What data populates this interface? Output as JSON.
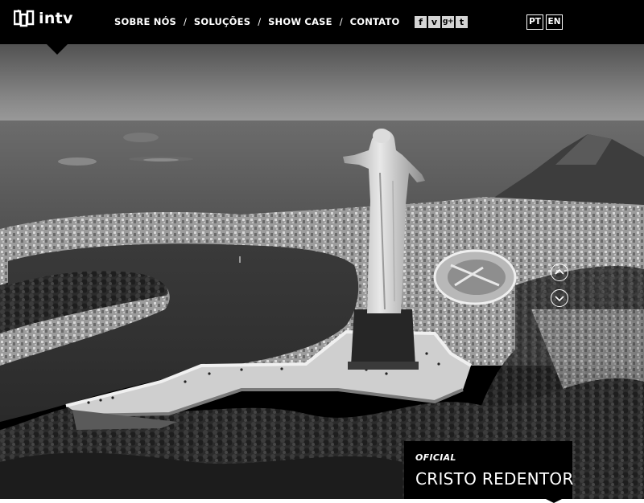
{
  "brand": {
    "name": "intv"
  },
  "nav": {
    "items": [
      {
        "label": "SOBRE NÓS"
      },
      {
        "label": "SOLUÇÕES"
      },
      {
        "label": "SHOW CASE"
      },
      {
        "label": "CONTATO"
      }
    ],
    "separator": "/"
  },
  "social": {
    "items": [
      {
        "icon": "facebook-icon",
        "glyph": "f"
      },
      {
        "icon": "vimeo-icon",
        "glyph": "v"
      },
      {
        "icon": "google-plus-icon",
        "glyph": "g+"
      },
      {
        "icon": "tumblr-icon",
        "glyph": "t"
      }
    ]
  },
  "languages": [
    {
      "code": "PT"
    },
    {
      "code": "EN"
    }
  ],
  "hero": {
    "image": "black-and-white aerial photograph of a statue on a mountain overlooking a city, lagoon and sea",
    "controls": {
      "up_icon": "chevron-up-icon",
      "down_icon": "chevron-down-icon"
    },
    "caption": {
      "kicker": "OFICIAL",
      "title": "CRISTO REDENTOR"
    }
  },
  "colors": {
    "header_bg": "#000000",
    "text": "#ffffff",
    "social_bg": "#d4d4d4"
  }
}
